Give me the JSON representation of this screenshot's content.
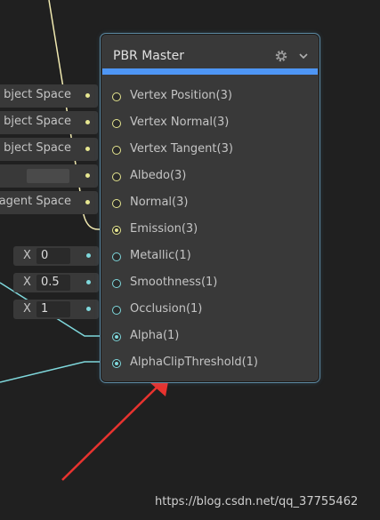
{
  "node": {
    "title": "PBR Master",
    "accent": "#4e96f5",
    "header_icons": [
      "gear-icon",
      "chevron-down-icon"
    ],
    "inputs": [
      {
        "label": "Vertex Position(3)",
        "color": "#e6e690",
        "connected": false
      },
      {
        "label": "Vertex Normal(3)",
        "color": "#e6e690",
        "connected": false
      },
      {
        "label": "Vertex Tangent(3)",
        "color": "#e6e690",
        "connected": false
      },
      {
        "label": "Albedo(3)",
        "color": "#e6e690",
        "connected": false
      },
      {
        "label": "Normal(3)",
        "color": "#e6e690",
        "connected": false
      },
      {
        "label": "Emission(3)",
        "color": "#e6e690",
        "connected": true
      },
      {
        "label": "Metallic(1)",
        "color": "#7fd8dc",
        "connected": false
      },
      {
        "label": "Smoothness(1)",
        "color": "#7fd8dc",
        "connected": false
      },
      {
        "label": "Occlusion(1)",
        "color": "#7fd8dc",
        "connected": false
      },
      {
        "label": "Alpha(1)",
        "color": "#7fd8dc",
        "connected": true
      },
      {
        "label": "AlphaClipThreshold(1)",
        "color": "#7fd8dc",
        "connected": true
      }
    ]
  },
  "slots": {
    "vertex_position": "bject Space",
    "vertex_normal": "bject Space",
    "vertex_tangent": "bject Space",
    "normal": "agent Space",
    "metallic_axis": "X",
    "metallic_value": "0",
    "smoothness_axis": "X",
    "smoothness_value": "0.5",
    "occlusion_axis": "X",
    "occlusion_value": "1"
  },
  "watermark": "https://blog.csdn.net/qq_37755462",
  "colors": {
    "background": "#202020",
    "vector_wire": "#e6e690",
    "float_wire": "#7fd8dc",
    "annotation_arrow": "#e8332f"
  }
}
